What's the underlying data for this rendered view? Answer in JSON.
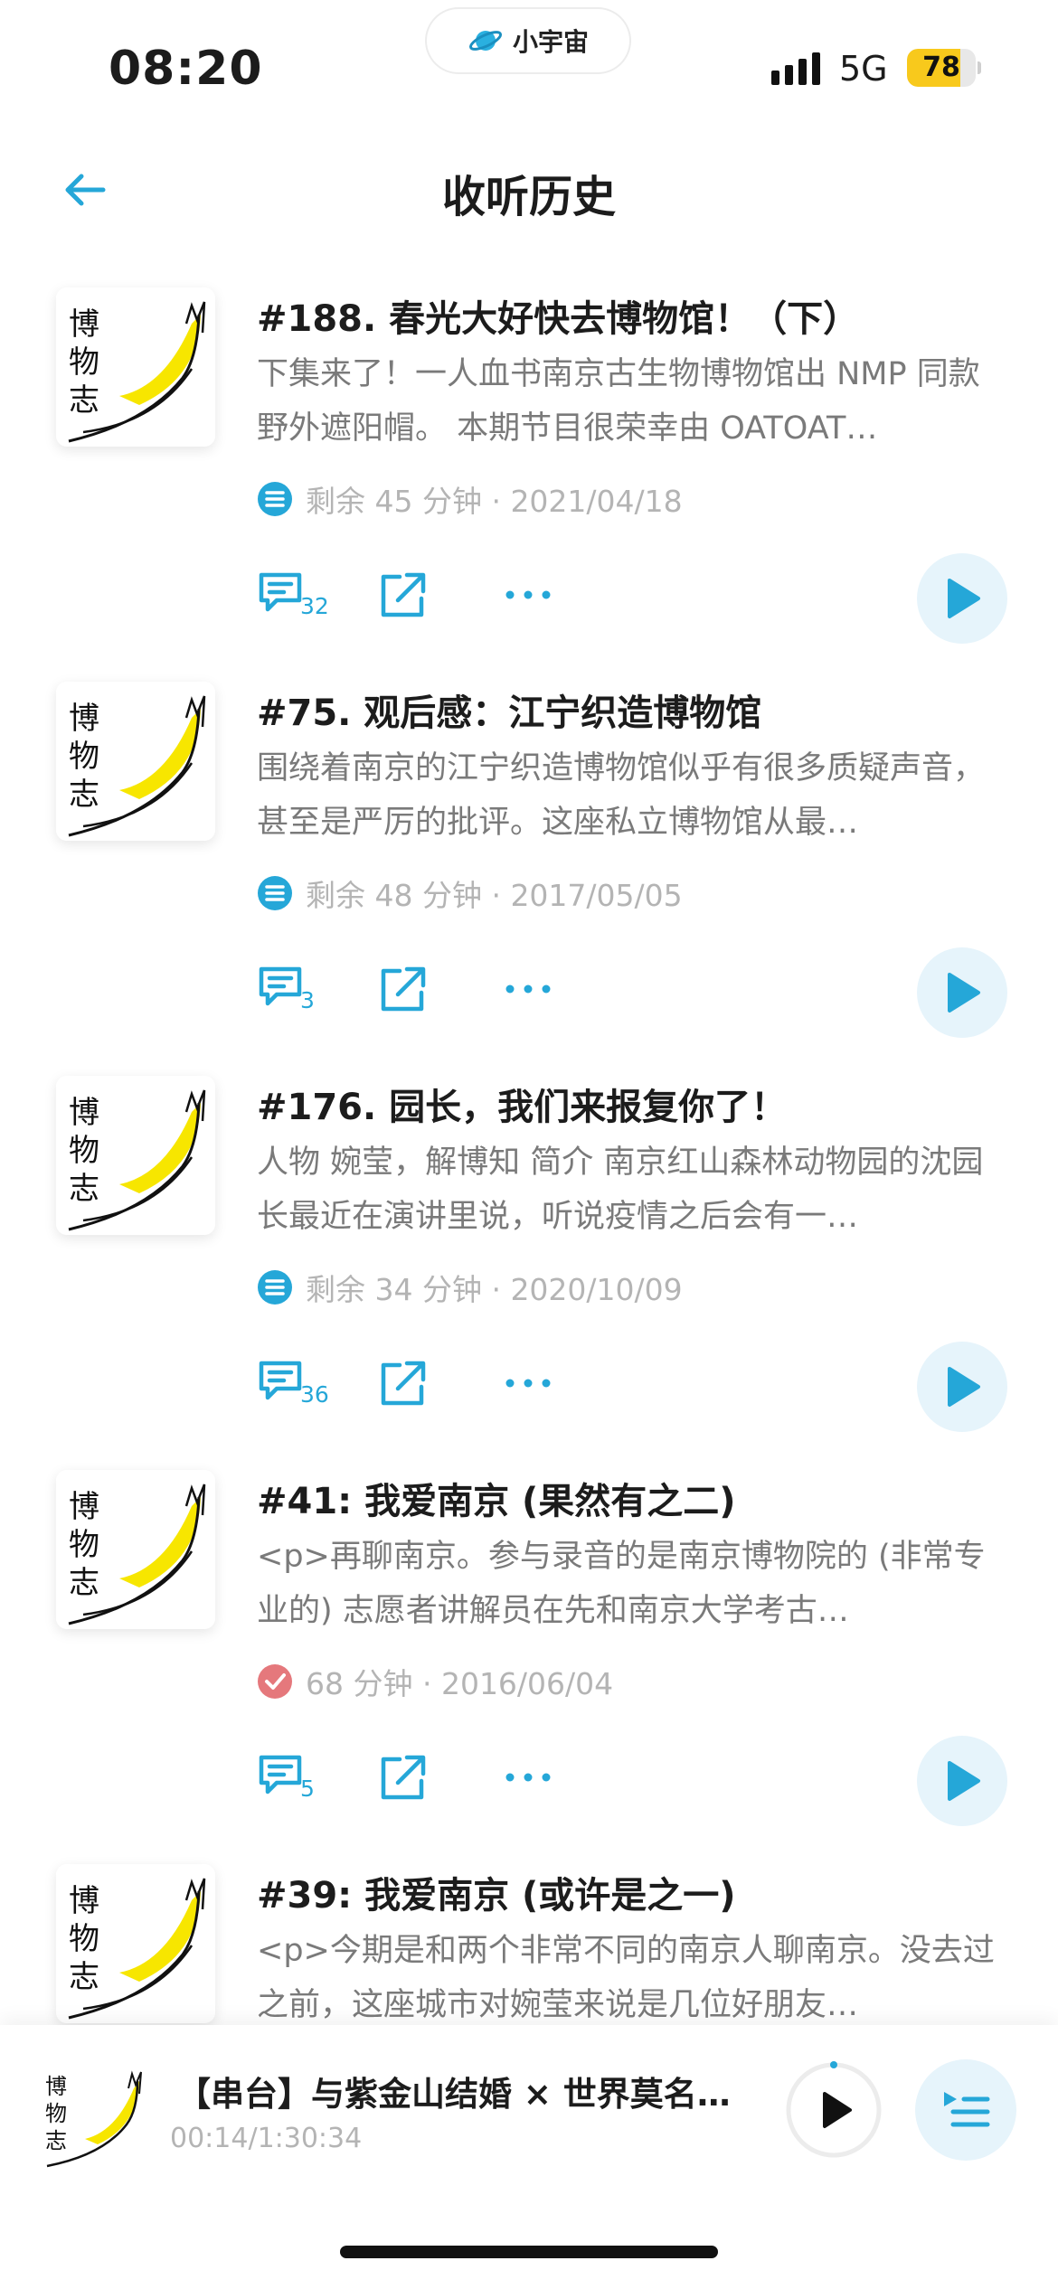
{
  "status_bar": {
    "time": "08:20",
    "app_badge": "小宇宙",
    "network": "5G",
    "battery_level": "78",
    "battery_fraction": 0.78,
    "battery_color": "#f8c91c"
  },
  "header": {
    "title": "收听历史",
    "back_icon": "arrow-left-icon"
  },
  "cover_text": [
    "博",
    "物",
    "志"
  ],
  "accent_color": "#25a7d8",
  "episodes": [
    {
      "title": "#188. 春光大好快去博物馆！（下）",
      "description": "下集来了！一人血书南京古生物博物馆出 NMP 同款野外遮阳帽。 本期节目很荣幸由 OATOAT…",
      "status": "partial",
      "meta": "剩余 45 分钟 · 2021/04/18",
      "comments": "32"
    },
    {
      "title": "#75. 观后感：江宁织造博物馆",
      "description": "围绕着南京的江宁织造博物馆似乎有很多质疑声音，甚至是严厉的批评。这座私立博物馆从最…",
      "status": "partial",
      "meta": "剩余 48 分钟 · 2017/05/05",
      "comments": "3"
    },
    {
      "title": "#176. 园长，我们来报复你了！",
      "description": "人物 婉莹，解博知 简介 南京红山森林动物园的沈园长最近在演讲里说，听说疫情之后会有一…",
      "status": "partial",
      "meta": "剩余 34 分钟 · 2020/10/09",
      "comments": "36"
    },
    {
      "title": "#41: 我爱南京 (果然有之二)",
      "description": "<p>再聊南京。参与录音的是南京博物院的 (非常专业的) 志愿者讲解员在先和南京大学考古…",
      "status": "finished",
      "meta": "68 分钟 · 2016/06/04",
      "comments": "5"
    },
    {
      "title": "#39: 我爱南京 (或许是之一)",
      "description": "<p>今期是和两个非常不同的南京人聊南京。没去过之前，这座城市对婉莹来说是几位好朋友…",
      "status": "partial",
      "meta": "",
      "comments": ""
    }
  ],
  "mini_player": {
    "title": "【串台】与紫金山结婚 × 世界莫名…",
    "time": "00:14/1:30:34",
    "progress_fraction": 0.003
  }
}
